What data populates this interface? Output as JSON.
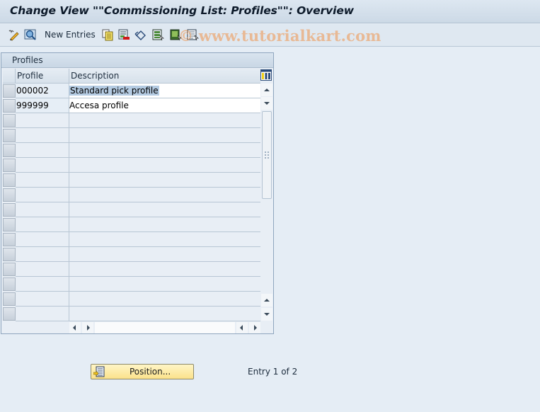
{
  "window": {
    "title": "Change View \"\"Commissioning List: Profiles\"\": Overview"
  },
  "toolbar": {
    "items": [
      {
        "icon": "display-change-icon"
      },
      {
        "icon": "find-icon"
      },
      {
        "label": "New Entries"
      },
      {
        "icon": "copy-as-icon"
      },
      {
        "icon": "delete-icon"
      },
      {
        "icon": "undo-change-icon"
      },
      {
        "icon": "select-all-icon"
      },
      {
        "icon": "select-block-icon"
      },
      {
        "icon": "deselect-all-icon"
      }
    ],
    "new_entries_label": "New Entries"
  },
  "watermark": "© www.tutorialkart.com",
  "table": {
    "panel_title": "Profiles",
    "columns": [
      "Profile",
      "Description"
    ],
    "rows": [
      {
        "profile": "000002",
        "description": "Standard pick profile",
        "highlighted": true
      },
      {
        "profile": "999999",
        "description": "Accesa profile",
        "highlighted": false
      }
    ],
    "empty_rows": 14
  },
  "footer": {
    "position_button": "Position...",
    "entry_info": "Entry 1 of 2"
  }
}
